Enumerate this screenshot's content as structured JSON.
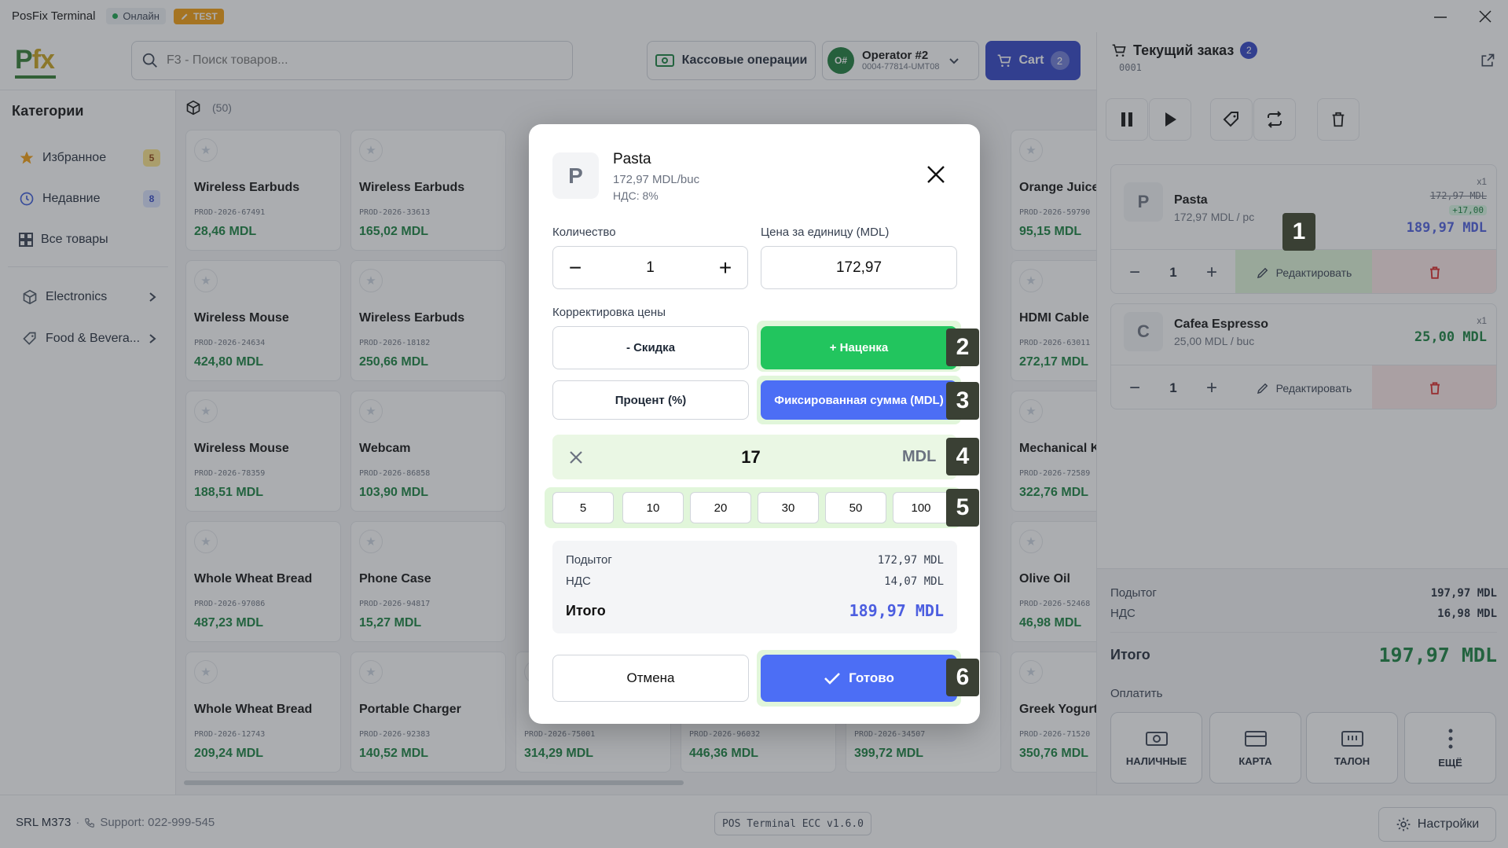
{
  "window": {
    "title": "PosFix Terminal",
    "status": "Онлайн",
    "env": "TEST"
  },
  "header": {
    "search_placeholder": "F3 - Поиск товаров...",
    "cash_ops": "Кассовые операции",
    "operator": {
      "initials": "O#",
      "name": "Operator #2",
      "id": "0004-77814-UMT08"
    },
    "cart": {
      "label": "Cart",
      "count": "2"
    }
  },
  "sidebar": {
    "title": "Категории",
    "items": [
      {
        "label": "Избранное",
        "count": "5"
      },
      {
        "label": "Недавние",
        "count": "8"
      },
      {
        "label": "Все товары"
      },
      {
        "label": "Electronics"
      },
      {
        "label": "Food & Bevera..."
      }
    ]
  },
  "products": {
    "count": "(50)",
    "cards": [
      {
        "name": "Wireless Earbuds",
        "sku": "PROD-2026-67491",
        "price": "28,46 MDL"
      },
      {
        "name": "Wireless Earbuds",
        "sku": "PROD-2026-33613",
        "price": "165,02 MDL"
      },
      {
        "name": "Orange Juice",
        "sku": "PROD-2026-59790",
        "price": "95,15 MDL"
      },
      {
        "name": "Wireless Mouse",
        "sku": "PROD-2026-24634",
        "price": "424,80 MDL"
      },
      {
        "name": "Wireless Earbuds",
        "sku": "PROD-2026-18182",
        "price": "250,66 MDL"
      },
      {
        "name": "HDMI Cable",
        "sku": "PROD-2026-63011",
        "price": "272,17 MDL"
      },
      {
        "name": "Wireless Mouse",
        "sku": "PROD-2026-78359",
        "price": "188,51 MDL"
      },
      {
        "name": "Webcam",
        "sku": "PROD-2026-86858",
        "price": "103,90 MDL"
      },
      {
        "name": "Mechanical Ke",
        "sku": "PROD-2026-72589",
        "price": "322,76 MDL"
      },
      {
        "name": "Whole Wheat Bread",
        "sku": "PROD-2026-97086",
        "price": "487,23 MDL"
      },
      {
        "name": "Phone Case",
        "sku": "PROD-2026-94817",
        "price": "15,27 MDL"
      },
      {
        "name": "Olive Oil",
        "sku": "PROD-2026-52468",
        "price": "46,98 MDL"
      },
      {
        "name": "Whole Wheat Bread",
        "sku": "PROD-2026-12743",
        "price": "209,24 MDL"
      },
      {
        "name": "Portable Charger",
        "sku": "PROD-2026-92383",
        "price": "140,52 MDL"
      },
      {
        "name": "",
        "sku": "PROD-2026-75001",
        "price": "314,29 MDL"
      },
      {
        "name": "",
        "sku": "PROD-2026-96032",
        "price": "446,36 MDL"
      },
      {
        "name": "",
        "sku": "PROD-2026-34507",
        "price": "399,72 MDL"
      },
      {
        "name": "Greek Yogurt",
        "sku": "PROD-2026-71520",
        "price": "350,76 MDL"
      }
    ]
  },
  "order": {
    "title": "Текущий заказ",
    "count": "2",
    "number": "0001",
    "lines": [
      {
        "initial": "P",
        "name": "Pasta",
        "unit": "172,97 MDL / pc",
        "qty_badge": "x1",
        "old_price": "172,97 MDL",
        "markup": "+17,00",
        "total": "189,97 MDL",
        "qty": "1",
        "edit": "Редактировать"
      },
      {
        "initial": "C",
        "name": "Cafea Espresso",
        "unit": "25,00 MDL / buc",
        "qty_badge": "x1",
        "total": "25,00 MDL",
        "qty": "1",
        "edit": "Редактировать"
      }
    ],
    "subtotal_label": "Подытог",
    "subtotal": "197,97 MDL",
    "vat_label": "НДС",
    "vat": "16,98 MDL",
    "total_label": "Итого",
    "total": "197,97 MDL",
    "pay_label": "Оплатить",
    "pay_methods": [
      "НАЛИЧНЫЕ",
      "КАРТА",
      "ТАЛОН",
      "ЕЩЁ"
    ]
  },
  "footer": {
    "company": "SRL M373",
    "support": "Support: 022-999-545",
    "version": "POS Terminal ECC v1.6.0",
    "settings": "Настройки"
  },
  "modal": {
    "initial": "P",
    "name": "Pasta",
    "unit_price": "172,97 MDL/buc",
    "vat_rate": "НДС: 8%",
    "qty_label": "Количество",
    "qty": "1",
    "price_label": "Цена за единицу (MDL)",
    "price": "172,97",
    "adjust_label": "Корректировка цены",
    "discount": "- Скидка",
    "markup": "+ Наценка",
    "percent": "Процент (%)",
    "fixed": "Фиксированная сумма (MDL)",
    "amount": "17",
    "currency": "MDL",
    "quick": [
      "5",
      "10",
      "20",
      "30",
      "50",
      "100"
    ],
    "subtotal_label": "Подытог",
    "subtotal": "172,97 MDL",
    "vat_label": "НДС",
    "vat": "14,07 MDL",
    "total_label": "Итого",
    "total": "189,97 MDL",
    "cancel": "Отмена",
    "done": "Готово"
  },
  "markers": [
    "1",
    "2",
    "3",
    "4",
    "5",
    "6"
  ],
  "colors": {
    "brand_blue": "#2f43c7",
    "accent_blue": "#4c6ef5",
    "green": "#22c55e",
    "price_green": "#15803d",
    "total_blue": "#4c5ee0"
  }
}
